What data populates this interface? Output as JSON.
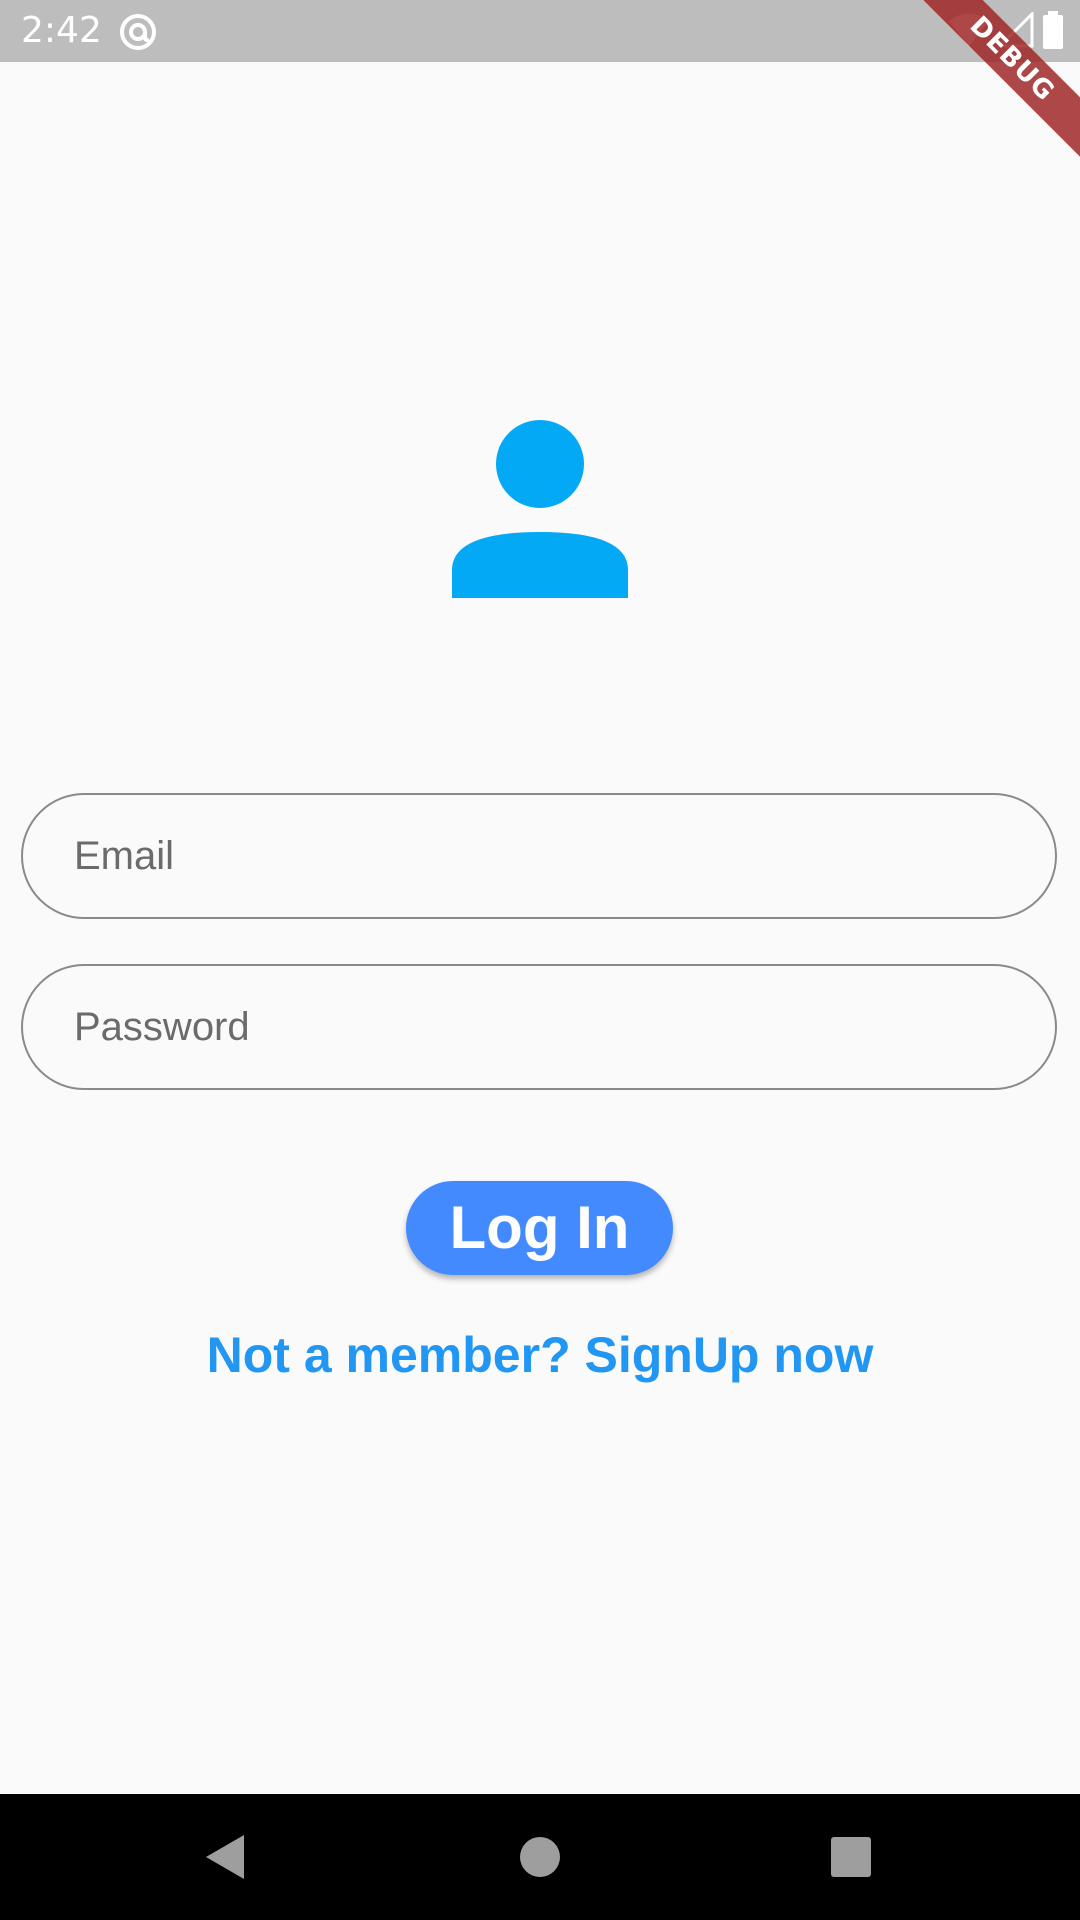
{
  "status_bar": {
    "time": "2:42",
    "icons": [
      "at-sign-notification-icon",
      "wifi-icon",
      "cell-signal-icon",
      "battery-icon"
    ]
  },
  "debug_banner": {
    "label": "DEBUG"
  },
  "avatar": {
    "icon": "person-icon",
    "color": "#03a9f4"
  },
  "login_form": {
    "email": {
      "placeholder": "Email",
      "value": ""
    },
    "password": {
      "placeholder": "Password",
      "value": ""
    },
    "login_button_label": "Log In",
    "signup_link_text": "Not a member? SignUp now"
  },
  "colors": {
    "button": "#448aff",
    "link": "#2196f3",
    "status_bar": "#bdbdbd",
    "background": "#fafafa"
  },
  "nav_bar": {
    "buttons": [
      "back-icon",
      "home-icon",
      "recents-icon"
    ]
  }
}
